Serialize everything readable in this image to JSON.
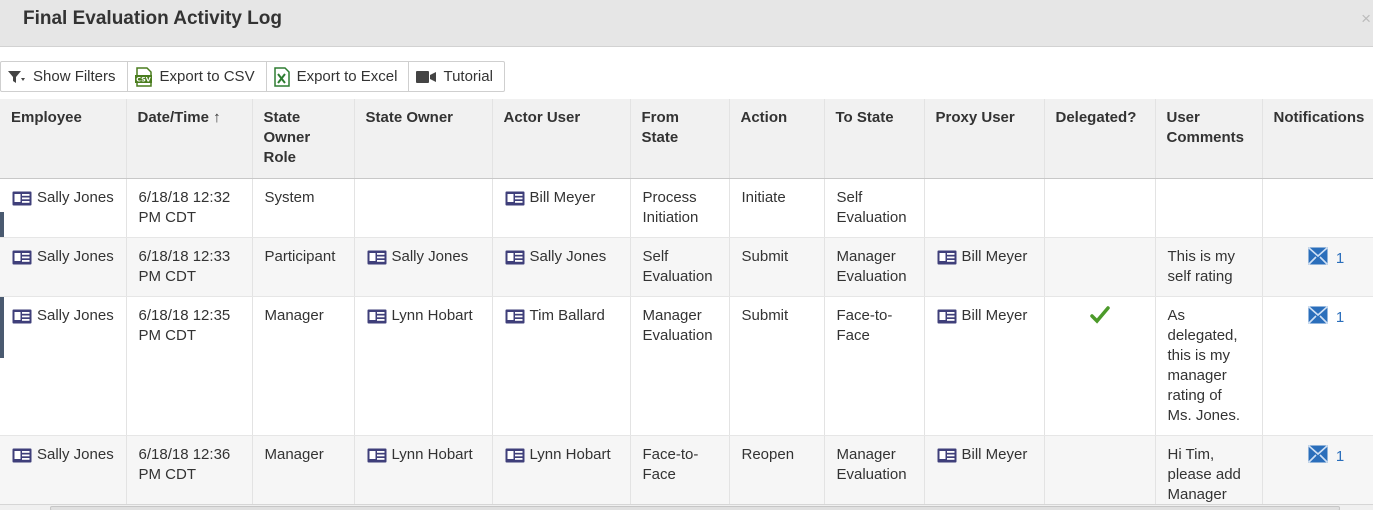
{
  "dialog": {
    "title": "Final Evaluation Activity Log",
    "close_label": "×"
  },
  "toolbar": [
    {
      "label": "Show Filters",
      "icon": "filter-icon"
    },
    {
      "label": "Export to CSV",
      "icon": "csv-file-icon"
    },
    {
      "label": "Export to Excel",
      "icon": "excel-file-icon"
    },
    {
      "label": "Tutorial",
      "icon": "video-camera-icon"
    }
  ],
  "columns": [
    "Employee",
    "Date/Time",
    "State Owner Role",
    "State Owner",
    "Actor User",
    "From State",
    "Action",
    "To State",
    "Proxy User",
    "Delegated?",
    "User Comments",
    "Notifications"
  ],
  "sort_indicator": "↑",
  "rows": [
    {
      "employee": "Sally Jones",
      "datetime": "6/18/18 12:32 PM CDT",
      "role": "System",
      "owner": "",
      "actor": "Bill Meyer",
      "from_state": "Process Initiation",
      "action": "Initiate",
      "to_state": "Self Evaluation",
      "proxy": "",
      "delegated": false,
      "comments": "",
      "notifications": ""
    },
    {
      "employee": "Sally Jones",
      "datetime": "6/18/18 12:33 PM CDT",
      "role": "Participant",
      "owner": "Sally Jones",
      "actor": "Sally Jones",
      "from_state": "Self Evaluation",
      "action": "Submit",
      "to_state": "Manager Evaluation",
      "proxy": "Bill Meyer",
      "delegated": false,
      "comments": "This is my self rating",
      "notifications": "1"
    },
    {
      "employee": "Sally Jones",
      "datetime": "6/18/18 12:35 PM CDT",
      "role": "Manager",
      "owner": "Lynn Hobart",
      "actor": "Tim Ballard",
      "from_state": "Manager Evaluation",
      "action": "Submit",
      "to_state": "Face-to-Face",
      "proxy": "Bill Meyer",
      "delegated": true,
      "comments": "As delegated, this is my manager rating of Ms. Jones.",
      "notifications": "1"
    },
    {
      "employee": "Sally Jones",
      "datetime": "6/18/18 12:36 PM CDT",
      "role": "Manager",
      "owner": "Lynn Hobart",
      "actor": "Lynn Hobart",
      "from_state": "Face-to-Face",
      "action": "Reopen",
      "to_state": "Manager Evaluation",
      "proxy": "Bill Meyer",
      "delegated": false,
      "comments": "Hi Tim, please add Manager Additional",
      "notifications": "1"
    }
  ],
  "colors": {
    "accent": "#2a6ebb",
    "card_icon": "#3f3f7a",
    "check": "#4c9a2a",
    "excel": "#2e7d32",
    "csv": "#4a7d1e"
  }
}
